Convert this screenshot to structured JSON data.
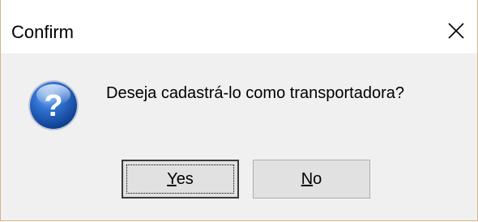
{
  "dialog": {
    "title": "Confirm",
    "message": "Deseja cadastrá-lo como transportadora?",
    "icon": "question-icon",
    "close_icon": "close-icon"
  },
  "buttons": {
    "yes": {
      "accel": "Y",
      "rest": "es"
    },
    "no": {
      "accel": "N",
      "rest": "o"
    }
  },
  "colors": {
    "dialog_bg": "#f0f0f0",
    "titlebar_bg": "#ffffff",
    "button_bg": "#e1e1e1",
    "icon_blue": "#1f5fb8"
  }
}
